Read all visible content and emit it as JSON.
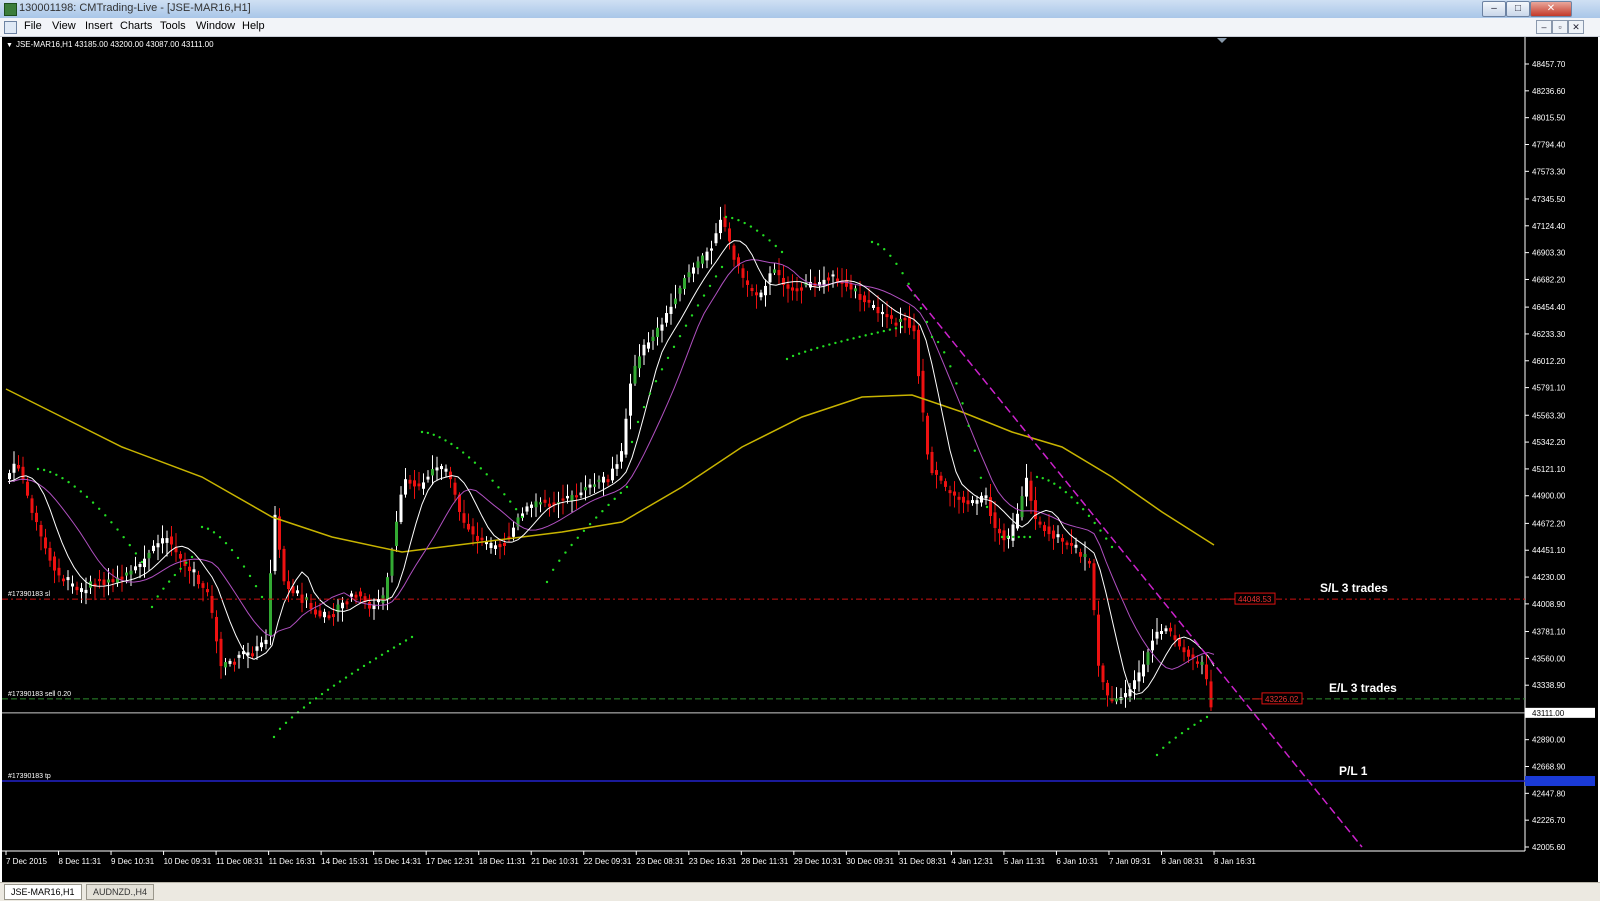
{
  "window": {
    "title": "130001198: CMTrading-Live - [JSE-MAR16,H1]",
    "min_label": "–",
    "max_label": "□",
    "close_label": "✕"
  },
  "menu": [
    "File",
    "View",
    "Insert",
    "Charts",
    "Tools",
    "Window",
    "Help"
  ],
  "mdi_buttons": [
    "–",
    "▫",
    "✕"
  ],
  "chart": {
    "header": "JSE-MAR16,H1  43185.00 43200.00 43087.00 43111.00",
    "price_labels": [
      "48457.70",
      "48236.60",
      "48015.50",
      "47794.40",
      "47573.30",
      "47345.50",
      "47124.40",
      "46903.30",
      "46682.20",
      "46454.40",
      "46233.30",
      "46012.20",
      "45791.10",
      "45563.30",
      "45342.20",
      "45121.10",
      "44900.00",
      "44672.20",
      "44451.10",
      "44230.00",
      "44008.90",
      "43781.10",
      "43560.00",
      "43338.90",
      "43111.00",
      "42890.00",
      "42668.90",
      "42447.80",
      "42226.70",
      "42005.60"
    ],
    "time_labels": [
      "7 Dec 2015",
      "8 Dec 11:31",
      "9 Dec 10:31",
      "10 Dec 09:31",
      "11 Dec 08:31",
      "11 Dec 16:31",
      "14 Dec 15:31",
      "15 Dec 14:31",
      "17 Dec 12:31",
      "18 Dec 11:31",
      "21 Dec 10:31",
      "22 Dec 09:31",
      "23 Dec 08:31",
      "23 Dec 16:31",
      "28 Dec 11:31",
      "29 Dec 10:31",
      "30 Dec 09:31",
      "31 Dec 08:31",
      "4 Jan 12:31",
      "5 Jan 11:31",
      "6 Jan 10:31",
      "7 Jan 09:31",
      "8 Jan 08:31",
      "8 Jan 16:31"
    ],
    "current_price": "43111.00",
    "lines": {
      "sl": {
        "label": "#17390183 sl",
        "price": "44048.53",
        "annotation": "S/L 3 trades",
        "color": "#cc1111"
      },
      "entry": {
        "label": "#17390183 sell 0.20",
        "price": "43226.02",
        "annotation": "E/L 3 trades",
        "color": "#2e8b2e"
      },
      "tp": {
        "label": "#17390183 tp",
        "annotation": "P/L 1",
        "color": "#2222cc"
      }
    },
    "colors": {
      "bull": "#ffffff",
      "bull_alt": "#33aa33",
      "bear": "#ee1111",
      "ma_slow": "#c8b400",
      "ma_fast": "#ffffff",
      "ma_mid": "#b050c0",
      "sar": "#22dd22",
      "trend": "#cc22cc"
    }
  },
  "tabs": [
    {
      "label": "JSE-MAR16,H1",
      "active": true
    },
    {
      "label": "AUDNZD.,H4",
      "active": false
    }
  ]
}
